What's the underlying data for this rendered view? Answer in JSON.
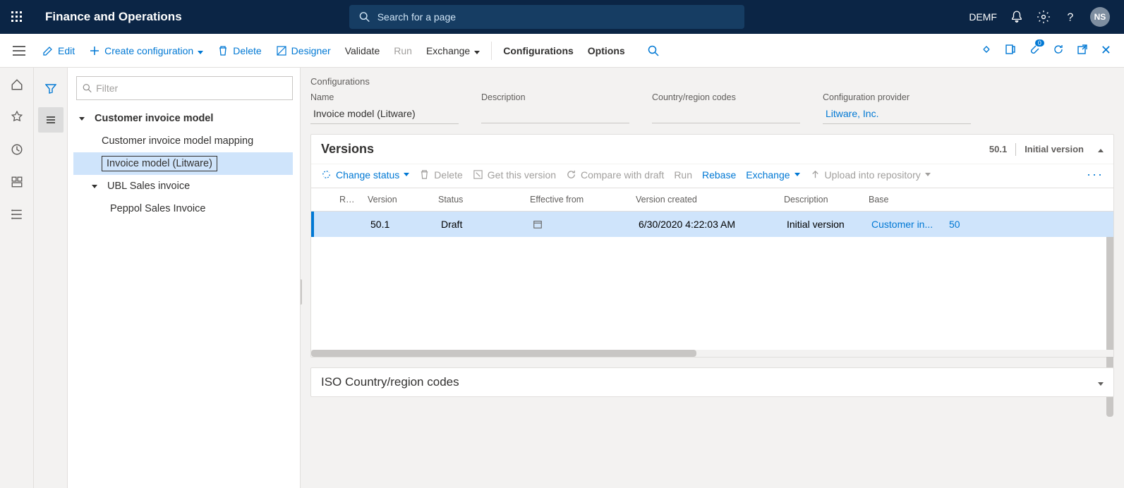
{
  "topbar": {
    "app_title": "Finance and Operations",
    "search_placeholder": "Search for a page",
    "company": "DEMF",
    "user_initials": "NS",
    "attachment_badge": "0"
  },
  "cmdbar": {
    "edit": "Edit",
    "create": "Create configuration",
    "delete": "Delete",
    "designer": "Designer",
    "validate": "Validate",
    "run": "Run",
    "exchange": "Exchange",
    "configurations": "Configurations",
    "options": "Options"
  },
  "tree": {
    "filter_placeholder": "Filter",
    "root": "Customer invoice model",
    "n1": "Customer invoice model mapping",
    "n2": "Invoice model (Litware)",
    "n3": "UBL Sales invoice",
    "n4": "Peppol Sales Invoice"
  },
  "detail": {
    "breadcrumb": "Configurations",
    "labels": {
      "name": "Name",
      "description": "Description",
      "country": "Country/region codes",
      "provider": "Configuration provider"
    },
    "name": "Invoice model (Litware)",
    "description": "",
    "country": "",
    "provider": "Litware, Inc."
  },
  "versions": {
    "title": "Versions",
    "summary_version": "50.1",
    "summary_desc": "Initial version",
    "actions": {
      "change_status": "Change status",
      "delete": "Delete",
      "get": "Get this version",
      "compare": "Compare with draft",
      "run": "Run",
      "rebase": "Rebase",
      "exchange": "Exchange",
      "upload": "Upload into repository"
    },
    "columns": {
      "re": "Re...",
      "version": "Version",
      "status": "Status",
      "effective": "Effective from",
      "created": "Version created",
      "description": "Description",
      "base": "Base"
    },
    "row": {
      "version": "50.1",
      "status": "Draft",
      "effective": "",
      "created": "6/30/2020 4:22:03 AM",
      "description": "Initial version",
      "base_name": "Customer in...",
      "base_num": "50"
    }
  },
  "iso": {
    "title": "ISO Country/region codes"
  }
}
